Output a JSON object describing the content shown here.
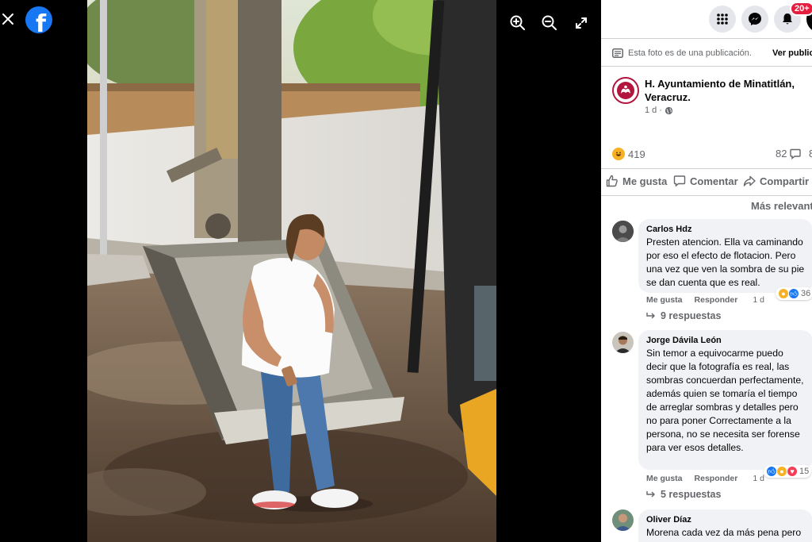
{
  "viewer": {
    "close_icon": "close-icon",
    "logo_letter": "f",
    "tools": [
      "zoom-in-icon",
      "zoom-out-icon",
      "fullscreen-icon"
    ]
  },
  "topbar": {
    "notification_badge": "20+"
  },
  "post": {
    "notice": "Esta foto es de una publicación.",
    "notice_link": "Ver publicación",
    "page_name": "H. Ayuntamiento de Minatitlán, Veracruz.",
    "time": "1 d",
    "reactions_count": "419",
    "comments_count": "82",
    "shares_count": "8",
    "actions": {
      "like": "Me gusta",
      "comment": "Comentar",
      "share": "Compartir"
    },
    "sort_label": "Más relevantes"
  },
  "comments": [
    {
      "name": "Carlos Hdz",
      "text": "Presten atencion. Ella va caminando por eso el efecto de flotacion. Pero una vez que ven la sombra de su pie se dan cuenta que es real.",
      "like": "Me gusta",
      "reply": "Responder",
      "time": "1 d",
      "reaction_count": "36",
      "replies": "9 respuestas"
    },
    {
      "name": "Jorge Dávila León",
      "text": "Sin temor a equivocarme puedo decir que la fotografía es real, las sombras concuerdan perfectamente, además quien se tomaría el tiempo de arreglar sombras y detalles pero no para poner Correctamente a la persona, no se necesita ser forense para ver esos detalles.",
      "like": "Me gusta",
      "reply": "Responder",
      "time": "1 d",
      "reaction_count": "15",
      "replies": "5 respuestas"
    },
    {
      "name": "Oliver Díaz",
      "text": "Morena cada vez da más pena pero"
    }
  ],
  "colors": {
    "facebook_blue": "#1877f2",
    "badge_red": "#e41e3f",
    "page_brand": "#b2153d",
    "excavator_yellow": "#e8a623"
  }
}
